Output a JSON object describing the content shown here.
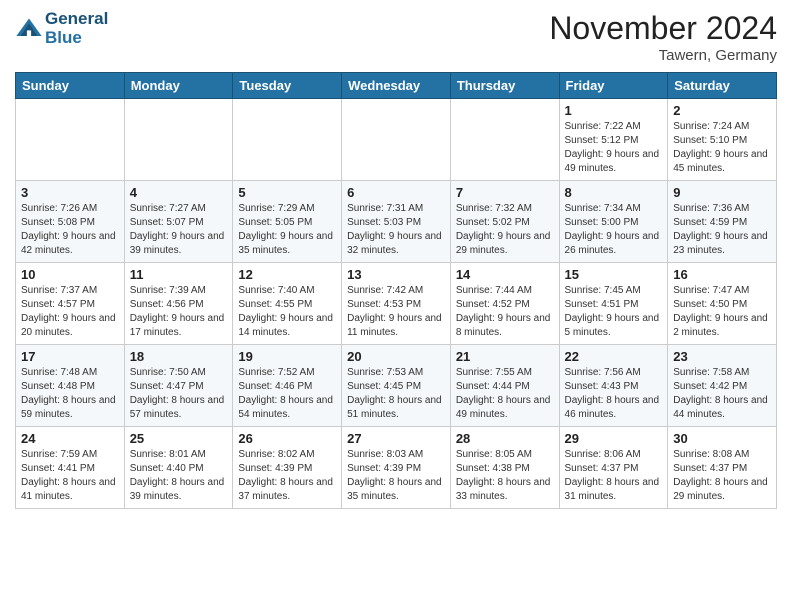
{
  "header": {
    "logo_line1": "General",
    "logo_line2": "Blue",
    "month": "November 2024",
    "location": "Tawern, Germany"
  },
  "days_of_week": [
    "Sunday",
    "Monday",
    "Tuesday",
    "Wednesday",
    "Thursday",
    "Friday",
    "Saturday"
  ],
  "weeks": [
    [
      {
        "day": "",
        "info": ""
      },
      {
        "day": "",
        "info": ""
      },
      {
        "day": "",
        "info": ""
      },
      {
        "day": "",
        "info": ""
      },
      {
        "day": "",
        "info": ""
      },
      {
        "day": "1",
        "info": "Sunrise: 7:22 AM\nSunset: 5:12 PM\nDaylight: 9 hours and 49 minutes."
      },
      {
        "day": "2",
        "info": "Sunrise: 7:24 AM\nSunset: 5:10 PM\nDaylight: 9 hours and 45 minutes."
      }
    ],
    [
      {
        "day": "3",
        "info": "Sunrise: 7:26 AM\nSunset: 5:08 PM\nDaylight: 9 hours and 42 minutes."
      },
      {
        "day": "4",
        "info": "Sunrise: 7:27 AM\nSunset: 5:07 PM\nDaylight: 9 hours and 39 minutes."
      },
      {
        "day": "5",
        "info": "Sunrise: 7:29 AM\nSunset: 5:05 PM\nDaylight: 9 hours and 35 minutes."
      },
      {
        "day": "6",
        "info": "Sunrise: 7:31 AM\nSunset: 5:03 PM\nDaylight: 9 hours and 32 minutes."
      },
      {
        "day": "7",
        "info": "Sunrise: 7:32 AM\nSunset: 5:02 PM\nDaylight: 9 hours and 29 minutes."
      },
      {
        "day": "8",
        "info": "Sunrise: 7:34 AM\nSunset: 5:00 PM\nDaylight: 9 hours and 26 minutes."
      },
      {
        "day": "9",
        "info": "Sunrise: 7:36 AM\nSunset: 4:59 PM\nDaylight: 9 hours and 23 minutes."
      }
    ],
    [
      {
        "day": "10",
        "info": "Sunrise: 7:37 AM\nSunset: 4:57 PM\nDaylight: 9 hours and 20 minutes."
      },
      {
        "day": "11",
        "info": "Sunrise: 7:39 AM\nSunset: 4:56 PM\nDaylight: 9 hours and 17 minutes."
      },
      {
        "day": "12",
        "info": "Sunrise: 7:40 AM\nSunset: 4:55 PM\nDaylight: 9 hours and 14 minutes."
      },
      {
        "day": "13",
        "info": "Sunrise: 7:42 AM\nSunset: 4:53 PM\nDaylight: 9 hours and 11 minutes."
      },
      {
        "day": "14",
        "info": "Sunrise: 7:44 AM\nSunset: 4:52 PM\nDaylight: 9 hours and 8 minutes."
      },
      {
        "day": "15",
        "info": "Sunrise: 7:45 AM\nSunset: 4:51 PM\nDaylight: 9 hours and 5 minutes."
      },
      {
        "day": "16",
        "info": "Sunrise: 7:47 AM\nSunset: 4:50 PM\nDaylight: 9 hours and 2 minutes."
      }
    ],
    [
      {
        "day": "17",
        "info": "Sunrise: 7:48 AM\nSunset: 4:48 PM\nDaylight: 8 hours and 59 minutes."
      },
      {
        "day": "18",
        "info": "Sunrise: 7:50 AM\nSunset: 4:47 PM\nDaylight: 8 hours and 57 minutes."
      },
      {
        "day": "19",
        "info": "Sunrise: 7:52 AM\nSunset: 4:46 PM\nDaylight: 8 hours and 54 minutes."
      },
      {
        "day": "20",
        "info": "Sunrise: 7:53 AM\nSunset: 4:45 PM\nDaylight: 8 hours and 51 minutes."
      },
      {
        "day": "21",
        "info": "Sunrise: 7:55 AM\nSunset: 4:44 PM\nDaylight: 8 hours and 49 minutes."
      },
      {
        "day": "22",
        "info": "Sunrise: 7:56 AM\nSunset: 4:43 PM\nDaylight: 8 hours and 46 minutes."
      },
      {
        "day": "23",
        "info": "Sunrise: 7:58 AM\nSunset: 4:42 PM\nDaylight: 8 hours and 44 minutes."
      }
    ],
    [
      {
        "day": "24",
        "info": "Sunrise: 7:59 AM\nSunset: 4:41 PM\nDaylight: 8 hours and 41 minutes."
      },
      {
        "day": "25",
        "info": "Sunrise: 8:01 AM\nSunset: 4:40 PM\nDaylight: 8 hours and 39 minutes."
      },
      {
        "day": "26",
        "info": "Sunrise: 8:02 AM\nSunset: 4:39 PM\nDaylight: 8 hours and 37 minutes."
      },
      {
        "day": "27",
        "info": "Sunrise: 8:03 AM\nSunset: 4:39 PM\nDaylight: 8 hours and 35 minutes."
      },
      {
        "day": "28",
        "info": "Sunrise: 8:05 AM\nSunset: 4:38 PM\nDaylight: 8 hours and 33 minutes."
      },
      {
        "day": "29",
        "info": "Sunrise: 8:06 AM\nSunset: 4:37 PM\nDaylight: 8 hours and 31 minutes."
      },
      {
        "day": "30",
        "info": "Sunrise: 8:08 AM\nSunset: 4:37 PM\nDaylight: 8 hours and 29 minutes."
      }
    ]
  ]
}
